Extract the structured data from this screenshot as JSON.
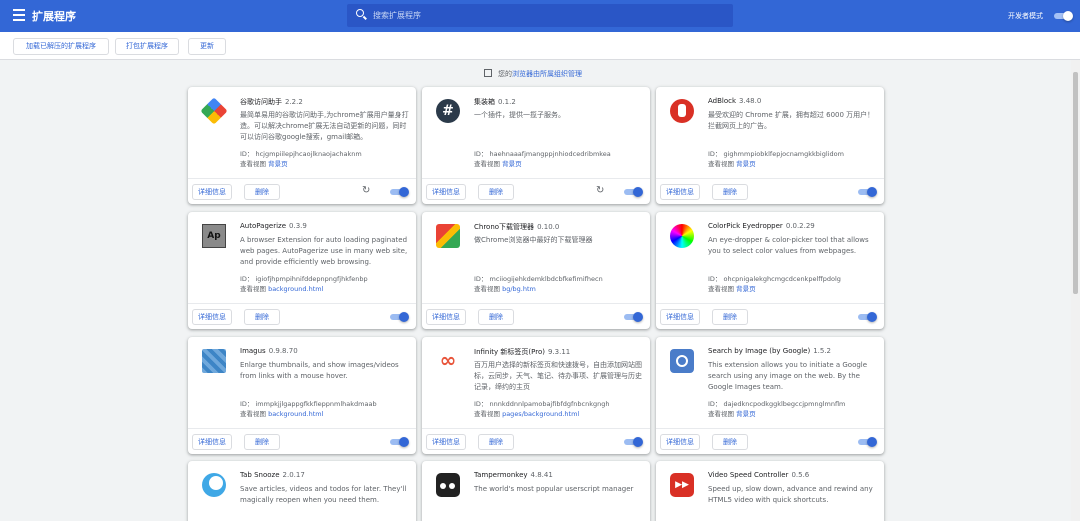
{
  "header": {
    "title": "扩展程序",
    "search_placeholder": "搜索扩展程序",
    "dev_mode_label": "开发者模式"
  },
  "toolbar": {
    "load_unpacked": "加载已解压的扩展程序",
    "pack": "打包扩展程序",
    "update": "更新"
  },
  "managed": {
    "prefix": "您的",
    "link": "浏览器由所属组织管理"
  },
  "labels": {
    "details": "详细信息",
    "remove": "删除",
    "view": "查看视图"
  },
  "extensions": [
    {
      "name": "谷歌访问助手",
      "version": "2.2.2",
      "desc": "最简单易用的谷歌访问助手,为chrome扩展用户量身打造。可以解决chrome扩展无法自动更新的问题，同时可以访问谷歌google搜索，gmail邮箱。",
      "id": "ID： hcjgmpiilepjhcaojlknaojachaknm",
      "view_link": "背景页",
      "icon": "google-access-icon"
    },
    {
      "name": "集装箱",
      "version": "0.1.2",
      "desc": "一个插件，提供一揽子服务。",
      "id": "ID： haehnaaafjmangppjnhiodcedribmkea",
      "view_link": "背景页",
      "icon": "hash-icon"
    },
    {
      "name": "AdBlock",
      "version": "3.48.0",
      "desc": "最受欢迎的 Chrome 扩展，拥有超过 6000 万用户！拦截网页上的广告。",
      "id": "ID： gighmmpiobklfepjocnamgkkbiglidom",
      "view_link": "背景页",
      "icon": "adblock-icon"
    },
    {
      "name": "AutoPagerize",
      "version": "0.3.9",
      "desc": "A browser Extension for auto loading paginated web pages. AutoPagerize use in many web site, and provide efficiently web browsing.",
      "id": "ID： igiofjhpmpihnifddepnpngfjhkfenbp",
      "view_link": "background.html",
      "icon": "autopagerize-icon"
    },
    {
      "name": "Chrono下载管理器",
      "version": "0.10.0",
      "desc": "做Chrome浏览器中最好的下载管理器",
      "id": "ID： mciiogijehkdemklbdcbfkefimifhecn",
      "view_link": "bg/bg.htm",
      "icon": "chrono-icon"
    },
    {
      "name": "ColorPick Eyedropper",
      "version": "0.0.2.29",
      "desc": "An eye-dropper & color-picker tool that allows you to select color values from webpages.",
      "id": "ID： ohcpnigalekghcmgcdcenkpelffpdolg",
      "view_link": "背景页",
      "icon": "colorpick-icon"
    },
    {
      "name": "Imagus",
      "version": "0.9.8.70",
      "desc": "Enlarge thumbnails, and show images/videos from links with a mouse hover.",
      "id": "ID： immpkjjlgappgfkkfieppnmlhakdmaab",
      "view_link": "background.html",
      "icon": "imagus-icon"
    },
    {
      "name": "Infinity 新标签页(Pro)",
      "version": "9.3.11",
      "desc": "百万用户选择的新标签页和快速拨号，自由添加网站图标，云同步，天气、笔记、待办事项、扩展管理与历史记录，缔约的主页",
      "id": "ID： nnnkddnnlpamobajfibfdgfnbcnkgngh",
      "view_link": "pages/background.html",
      "icon": "infinity-icon"
    },
    {
      "name": "Search by Image (by Google)",
      "version": "1.5.2",
      "desc": "This extension allows you to initiate a Google search using any image on the web. By the Google Images team.",
      "id": "ID： dajedkncpodkggklbegccjpmnglmnflm",
      "view_link": "背景页",
      "icon": "camera-icon"
    },
    {
      "name": "Tab Snooze",
      "version": "2.0.17",
      "desc": "Save articles, videos and todos for later. They'll magically reopen when you need them.",
      "icon": "tab-snooze-icon"
    },
    {
      "name": "Tampermonkey",
      "version": "4.8.41",
      "desc": "The world's most popular userscript manager",
      "icon": "tampermonkey-icon"
    },
    {
      "name": "Video Speed Controller",
      "version": "0.5.6",
      "desc": "Speed up, slow down, advance and rewind any HTML5 video with quick shortcuts.",
      "icon": "video-speed-icon"
    }
  ]
}
